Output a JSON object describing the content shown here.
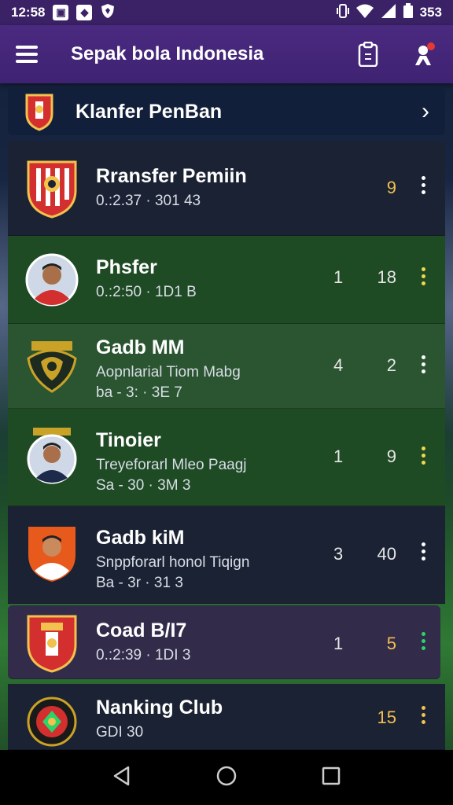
{
  "status": {
    "time": "12:58",
    "battery": "353",
    "left_icons": [
      "gallery-icon",
      "app-icon",
      "shield-icon"
    ],
    "right_icons": [
      "vibrate-icon",
      "wifi-icon",
      "signal-icon",
      "battery-icon"
    ]
  },
  "app_bar": {
    "title": "Sepak bola Indonesia",
    "menu_icon": "hamburger-icon",
    "action_icons": [
      "clipboard-icon",
      "profile-notification-icon"
    ]
  },
  "section": {
    "title": "Klanfer PenBan",
    "chevron": "›"
  },
  "rows": [
    {
      "name": "Rransfer Pemiin",
      "sub": "0.:2.37 · 301 43",
      "sub2": "",
      "n1": "",
      "n2": "9",
      "n2_color": "#f2c14e",
      "dots_color": "#ffffff",
      "bg": "#1b2233",
      "avatar": "red-crest"
    },
    {
      "name": "Phsfer",
      "sub": "0.:2:50 · 1D1 B",
      "sub2": "",
      "n1": "1",
      "n2": "18",
      "n2_color": "#e6e6e6",
      "dots_color": "#f2d84e",
      "bg": "#1e4a24",
      "avatar": "player-1"
    },
    {
      "name": "Gadb MM",
      "sub": "Aopnlarial Tiom Mabg",
      "sub2": "ba - 3: · 3E 7",
      "n1": "4",
      "n2": "2",
      "n2_color": "#e6e6e6",
      "dots_color": "#ffffff",
      "bg": "#2a5530",
      "avatar": "garuda-crest"
    },
    {
      "name": "Tinoier",
      "sub": "Treyeforarl Mleo Paagj",
      "sub2": "Sa - 30 · 3M 3",
      "n1": "1",
      "n2": "9",
      "n2_color": "#e6e6e6",
      "dots_color": "#f2d84e",
      "bg": "#1e4a24",
      "avatar": "player-2"
    },
    {
      "name": "Gadb kiM",
      "sub": "Snppforarl honol Tiqign",
      "sub2": "Ba - 3r · 31 3",
      "n1": "3",
      "n2": "40",
      "n2_color": "#e6e6e6",
      "dots_color": "#ffffff",
      "bg": "#1b2233",
      "avatar": "player-3"
    },
    {
      "name": "Coad B/I7",
      "sub": "0.:2:39 · 1DI 3",
      "sub2": "",
      "n1": "1",
      "n2": "5",
      "n2_color": "#f2c14e",
      "dots_color": "#2bd46a",
      "bg": "#332b4a",
      "avatar": "red-crest-2"
    },
    {
      "name": "Nanking Club",
      "sub": "GDI 30",
      "sub2": "",
      "n1": "",
      "n2": "15",
      "n2_color": "#f2c14e",
      "dots_color": "#f2c14e",
      "bg": "#1b2233",
      "avatar": "club-crest"
    }
  ],
  "nav": {
    "back": "back-icon",
    "home": "home-icon",
    "recents": "recents-icon"
  }
}
